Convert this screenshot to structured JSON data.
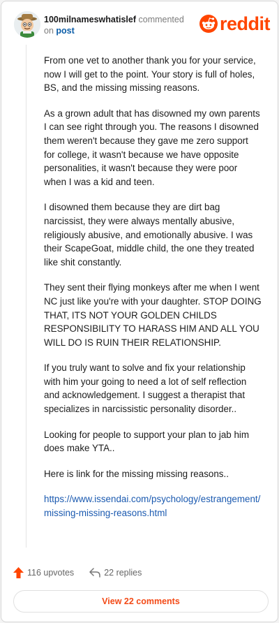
{
  "header": {
    "username": "100milnameswhatislef",
    "action_text": "commented",
    "on_text": "on",
    "post_link": "post",
    "logo_text": "reddit"
  },
  "comment": {
    "paragraphs": [
      "From one vet to another thank you for your service, now I will get to the point. Your story is full of holes, BS, and the missing missing reasons.",
      "As a grown adult that has disowned my own parents I can see right through you. The reasons I disowned them weren't because they gave me zero support for college, it wasn't because we have opposite personalities, it wasn't because they were poor when I was a kid and teen.",
      "I disowned them because they are dirt bag narcissist, they were always mentally abusive, religiously abusive, and emotionally abusive. I was their ScapeGoat, middle child, the one they treated like shit constantly.",
      "They sent their flying monkeys after me when I went NC just like you're with your daughter. STOP DOING THAT, ITS NOT YOUR GOLDEN CHILDS RESPONSIBILITY TO HARASS HIM AND ALL YOU WILL DO IS RUIN THEIR RELATIONSHIP.",
      "If you truly want to solve and fix your relationship with him your going to need a lot of self reflection and acknowledgement. I suggest a therapist that specializes in narcissistic personality disorder..",
      "Looking for people to support your plan to jab him does make YTA..",
      "Here is link for the missing missing reasons.."
    ],
    "link": "https://www.issendai.com/psychology/estrangement/missing-missing-reasons.html"
  },
  "footer": {
    "upvotes": "116 upvotes",
    "replies": "22 replies",
    "view_button": "View 22 comments"
  },
  "colors": {
    "brand": "#ff4500",
    "link": "#1b5ab0",
    "muted": "#7c7c7c"
  },
  "icons": {
    "upvote": "upvote-arrow-icon",
    "reply": "reply-arrow-icon",
    "logo": "reddit-snoo-icon",
    "avatar": "user-avatar"
  }
}
